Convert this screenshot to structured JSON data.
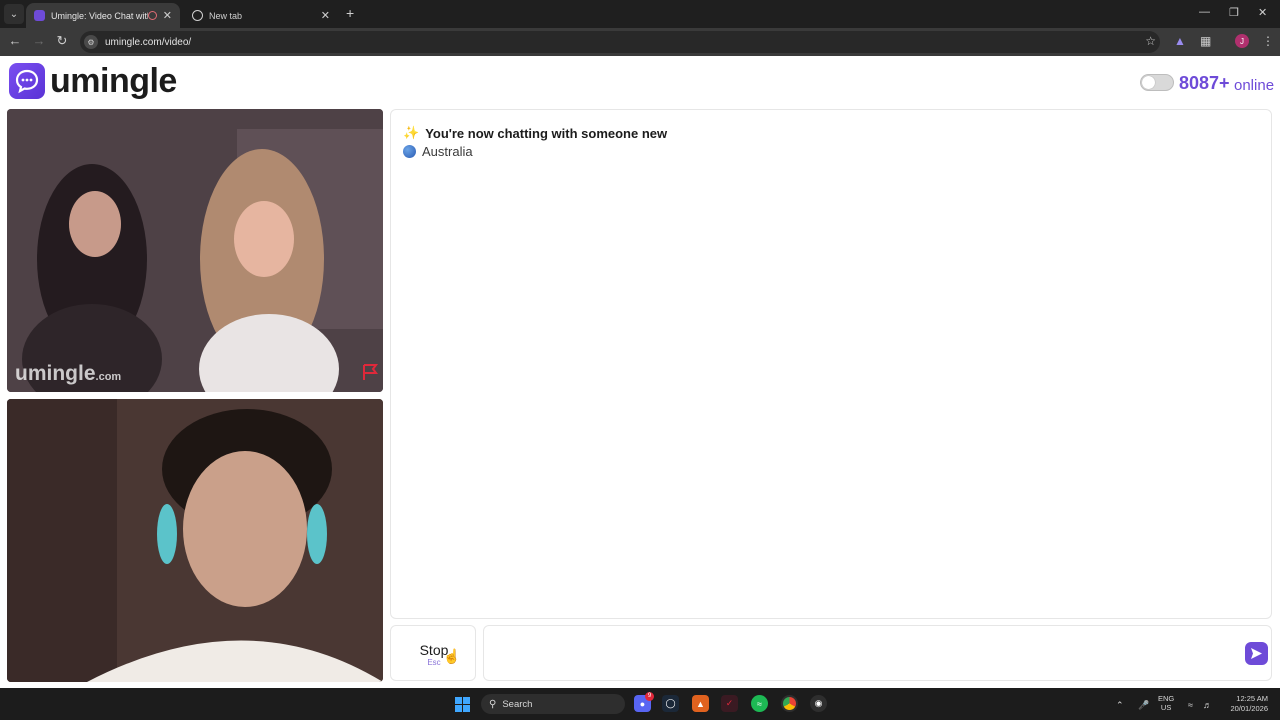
{
  "browser": {
    "active_tab_title": "Umingle: Video Chat with S",
    "inactive_tab_title": "New tab",
    "url": "umingle.com/video/",
    "profile_initial": "J"
  },
  "header": {
    "logo_text": "umingle",
    "online_count": "8087+",
    "online_label": "online"
  },
  "video": {
    "watermark_main": "umingle",
    "watermark_suffix": ".com"
  },
  "chat": {
    "status_message": "You're now chatting with someone new",
    "country": "Australia",
    "stop_label": "Stop",
    "stop_hint": "Esc",
    "message_placeholder": ""
  },
  "taskbar": {
    "search_label": "Search",
    "lang_top": "ENG",
    "lang_bottom": "US",
    "time": "12:25 AM",
    "date": "20/01/2026",
    "discord_badge": "9"
  },
  "colors": {
    "brand": "#6e4bd8",
    "brand_dark": "#5a33d6"
  },
  "icons": {
    "tab_favicon": "umingle-logo-icon",
    "send": "send-arrow-icon",
    "report": "flag-icon"
  }
}
